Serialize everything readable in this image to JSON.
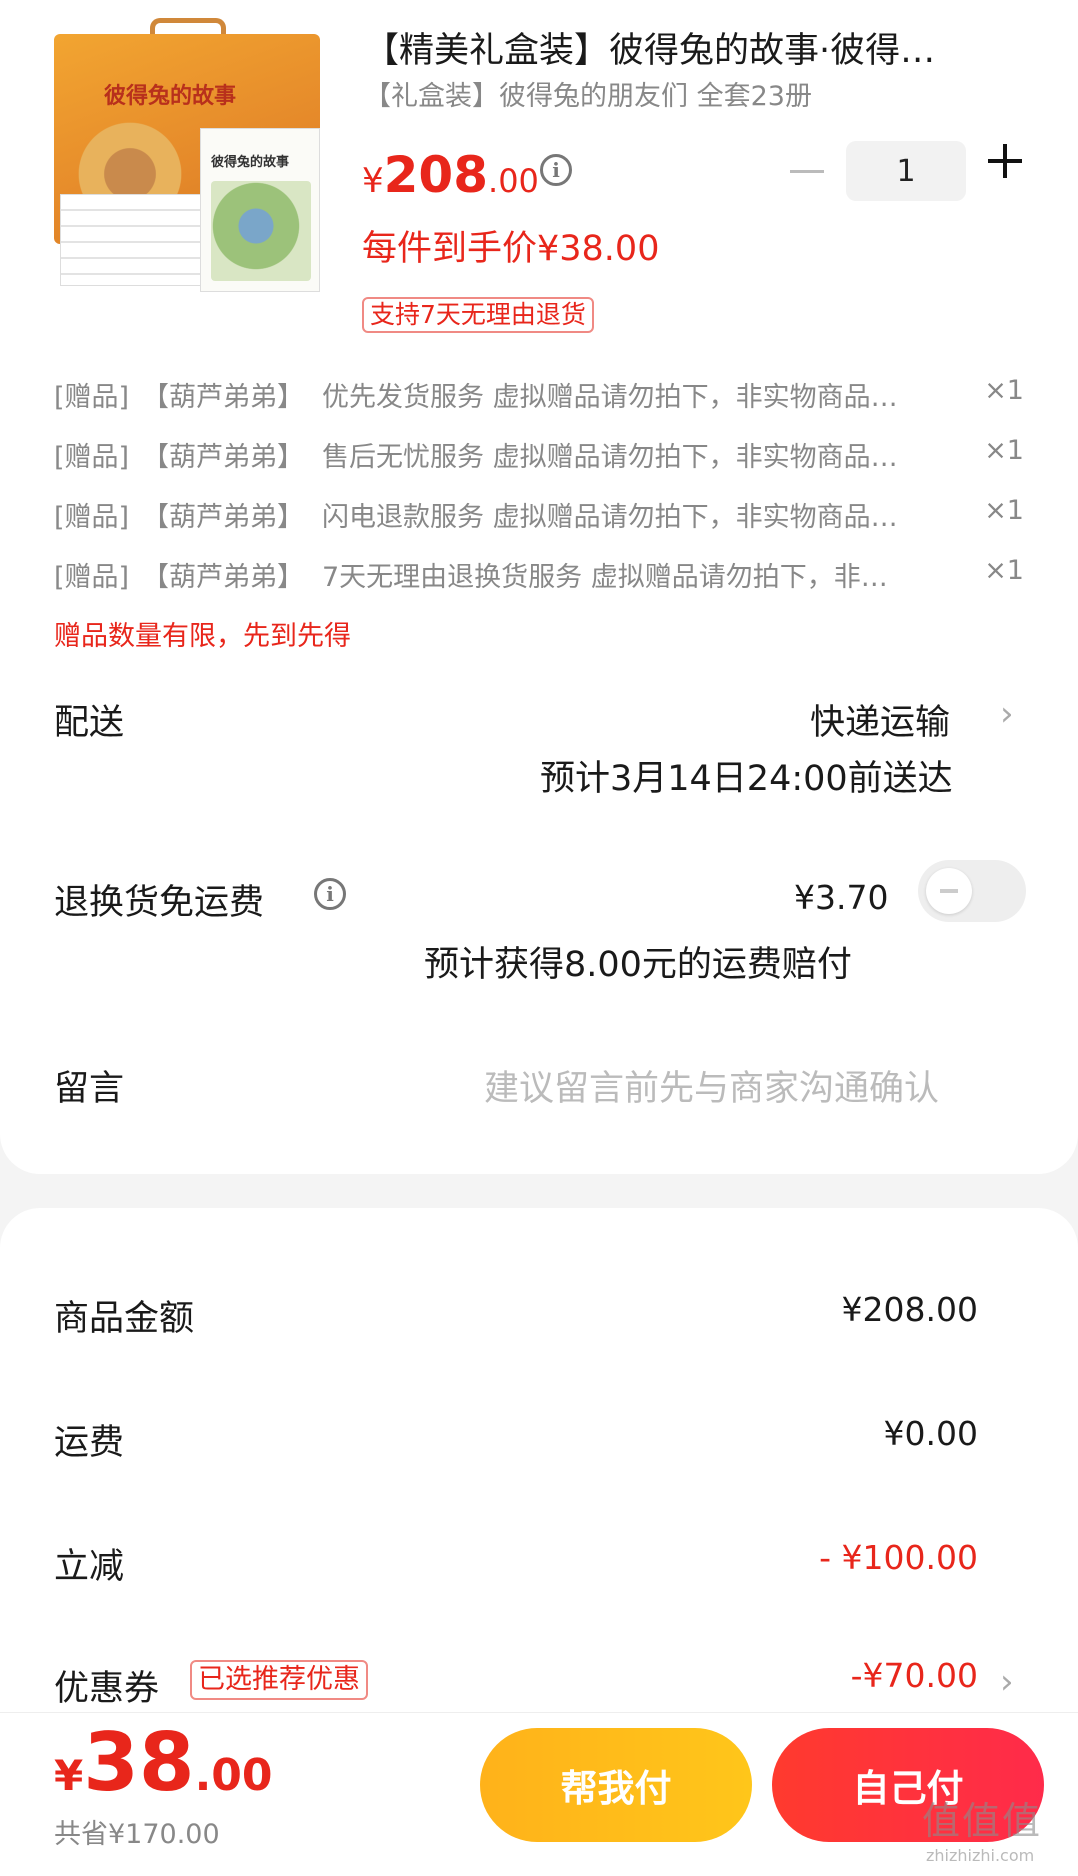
{
  "product": {
    "title": "【精美礼盒装】彼得兔的故事·彼得…",
    "subtitle": "【礼盒装】彼得兔的朋友们 全套23册",
    "image_text": {
      "box_title": "彼得兔的故事",
      "book_title": "彼得兔的故事"
    },
    "price_currency": "¥",
    "price_int": "208",
    "price_dec": ".00",
    "quantity": "1",
    "per_item_price": "每件到手价¥38.00",
    "return_policy_tag": "支持7天无理由退货"
  },
  "gifts": [
    {
      "tag": "[赠品]",
      "shop": "【葫芦弟弟】",
      "name": "优先发货服务 虚拟赠品请勿拍下，非实物商品…",
      "count": "×1"
    },
    {
      "tag": "[赠品]",
      "shop": "【葫芦弟弟】",
      "name": "售后无忧服务 虚拟赠品请勿拍下，非实物商品…",
      "count": "×1"
    },
    {
      "tag": "[赠品]",
      "shop": "【葫芦弟弟】",
      "name": "闪电退款服务 虚拟赠品请勿拍下，非实物商品…",
      "count": "×1"
    },
    {
      "tag": "[赠品]",
      "shop": "【葫芦弟弟】",
      "name": "7天无理由退换货服务 虚拟赠品请勿拍下，非…",
      "count": "×1"
    }
  ],
  "gift_limit_note": "赠品数量有限，先到先得",
  "shipping": {
    "label": "配送",
    "method": "快递运输",
    "eta": "预计3月14日24:00前送达"
  },
  "return_insurance": {
    "label": "退换货免运费",
    "price": "¥3.70",
    "compensation": "预计获得8.00元的运费赔付",
    "enabled": false
  },
  "message": {
    "label": "留言",
    "placeholder": "建议留言前先与商家沟通确认"
  },
  "summary": {
    "goods_label": "商品金额",
    "goods_value": "¥208.00",
    "freight_label": "运费",
    "freight_value": "¥0.00",
    "discount_label": "立减",
    "discount_value": "- ¥100.00",
    "coupon_label": "优惠券",
    "coupon_tag": "已选推荐优惠",
    "coupon_value": "-¥70.00"
  },
  "bottom": {
    "total_currency": "¥",
    "total_int": "38",
    "total_dec": ".00",
    "saved": "共省¥170.00",
    "help_pay": "帮我付",
    "self_pay": "自己付"
  },
  "watermark": {
    "text": "值值值",
    "url": "zhizhizhi.com"
  },
  "colors": {
    "accent_red": "#e8261b",
    "help_button": "#ffb21a",
    "self_button": "#ff3a2e"
  }
}
